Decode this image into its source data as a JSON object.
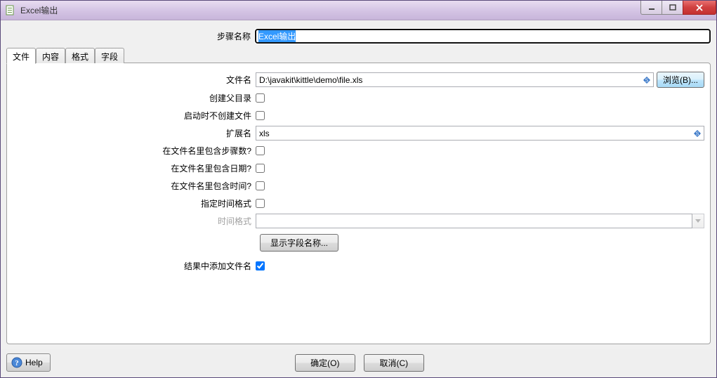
{
  "window": {
    "title": "Excel输出"
  },
  "controls": {
    "minimize": "—",
    "maximize": "▢",
    "close": "✕"
  },
  "stepName": {
    "label": "步骤名称",
    "value": "Excel输出"
  },
  "tabs": {
    "file": "文件",
    "content": "内容",
    "format": "格式",
    "fields": "字段"
  },
  "fileTab": {
    "filenameLabel": "文件名",
    "filenameValue": "D:\\javakit\\kittle\\demo\\file.xls",
    "browse": "浏览(B)...",
    "createParentDirLabel": "创建父目录",
    "createParentDir": false,
    "dontCreateOnStartLabel": "启动时不创建文件",
    "dontCreateOnStart": false,
    "extensionLabel": "扩展名",
    "extensionValue": "xls",
    "stepNumInFilenameLabel": "在文件名里包含步骤数?",
    "stepNumInFilename": false,
    "dateInFilenameLabel": "在文件名里包含日期?",
    "dateInFilename": false,
    "timeInFilenameLabel": "在文件名里包含时间?",
    "timeInFilename": false,
    "specifyTimeFormatLabel": "指定时间格式",
    "specifyTimeFormat": false,
    "timeFormatLabel": "时间格式",
    "timeFormatValue": "",
    "showFieldNames": "显示字段名称...",
    "addFilenameToResultLabel": "结果中添加文件名",
    "addFilenameToResult": true
  },
  "buttons": {
    "help": "Help",
    "ok": "确定(O)",
    "cancel": "取消(C)"
  }
}
